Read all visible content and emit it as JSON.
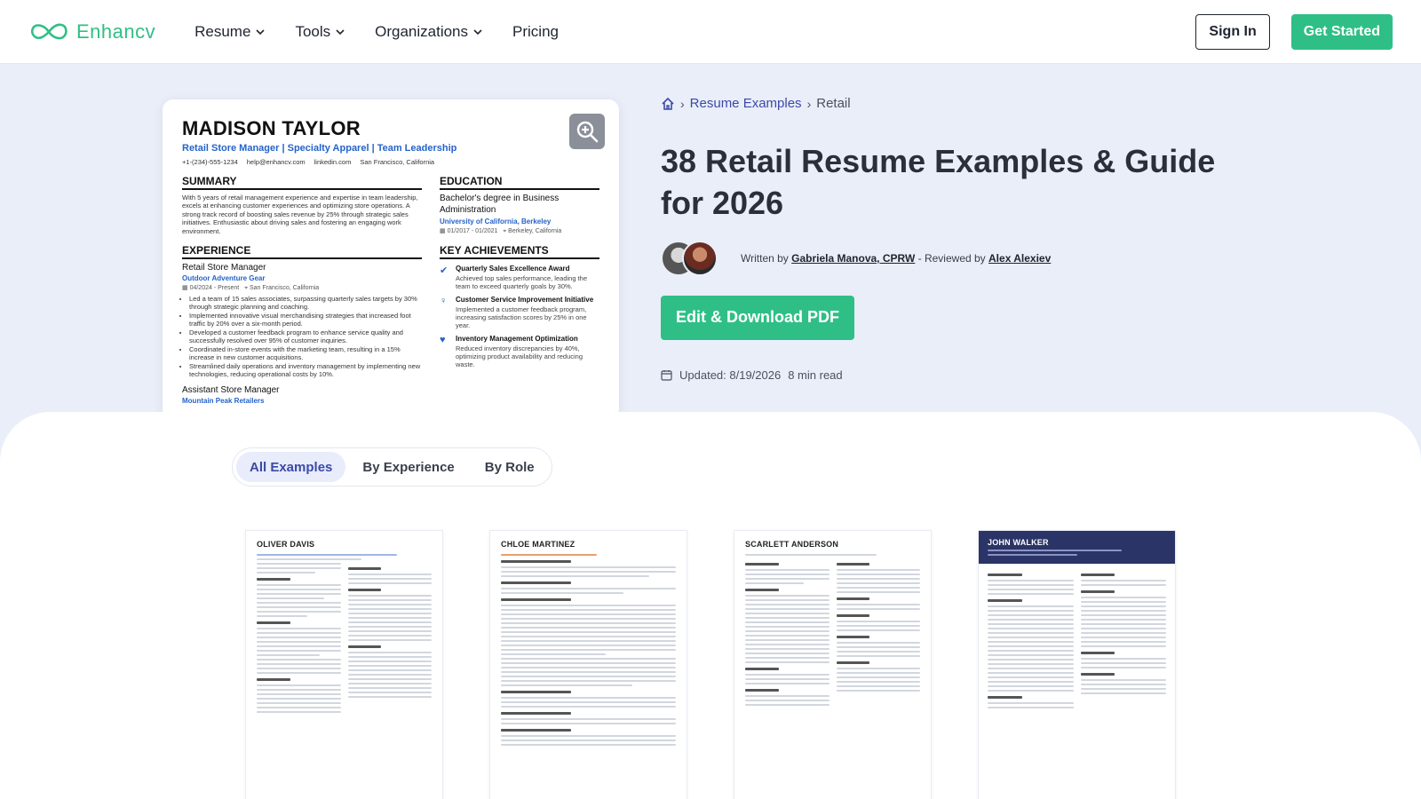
{
  "brand": {
    "name": "Enhancv",
    "color": "#2fbf86"
  },
  "nav": {
    "items": [
      {
        "label": "Resume",
        "has_dropdown": true
      },
      {
        "label": "Tools",
        "has_dropdown": true
      },
      {
        "label": "Organizations",
        "has_dropdown": true
      },
      {
        "label": "Pricing",
        "has_dropdown": false
      }
    ],
    "sign_in": "Sign In",
    "get_started": "Get Started"
  },
  "resume": {
    "name": "MADISON TAYLOR",
    "role": "Retail Store Manager | Specialty Apparel | Team Leadership",
    "contact": [
      "+1-(234)-555-1234",
      "help@enhancv.com",
      "linkedin.com",
      "San Francisco, California"
    ],
    "summary_h": "SUMMARY",
    "summary": "With 5 years of retail management experience and expertise in team leadership, excels at enhancing customer experiences and optimizing store operations. A strong track record of boosting sales revenue by 25% through strategic sales initiatives. Enthusiastic about driving sales and fostering an engaging work environment.",
    "experience_h": "EXPERIENCE",
    "job1": {
      "title": "Retail Store Manager",
      "company": "Outdoor Adventure Gear",
      "dates": "04/2024 - Present",
      "location": "San Francisco, California",
      "bullets": [
        "Led a team of 15 sales associates, surpassing quarterly sales targets by 30% through strategic planning and coaching.",
        "Implemented innovative visual merchandising strategies that increased foot traffic by 20% over a six-month period.",
        "Developed a customer feedback program to enhance service quality and successfully resolved over 95% of customer inquiries.",
        "Coordinated in-store events with the marketing team, resulting in a 15% increase in new customer acquisitions.",
        "Streamlined daily operations and inventory management by implementing new technologies, reducing operational costs by 10%."
      ]
    },
    "job2": {
      "title": "Assistant Store Manager",
      "company": "Mountain Peak Retailers"
    },
    "education_h": "EDUCATION",
    "edu": {
      "degree": "Bachelor's degree in Business Administration",
      "school": "University of California, Berkeley",
      "dates": "01/2017 - 01/2021",
      "location": "Berkeley, California"
    },
    "achievements_h": "KEY ACHIEVEMENTS",
    "achievements": [
      {
        "icon": "check-icon",
        "title": "Quarterly Sales Excellence Award",
        "desc": "Achieved top sales performance, leading the team to exceed quarterly goals by 30%."
      },
      {
        "icon": "lightbulb-icon",
        "title": "Customer Service Improvement Initiative",
        "desc": "Implemented a customer feedback program, increasing satisfaction scores by 25% in one year."
      },
      {
        "icon": "heart-icon",
        "title": "Inventory Management Optimization",
        "desc": "Reduced inventory discrepancies by 40%, optimizing product availability and reducing waste."
      }
    ]
  },
  "breadcrumb": {
    "home_icon": "home-icon",
    "section": "Resume Examples",
    "current": "Retail"
  },
  "page": {
    "title": "38 Retail Resume Examples & Guide for 2026",
    "written_by_label": "Written by",
    "author": "Gabriela Manova, CPRW",
    "reviewed_by_label": "- Reviewed by",
    "reviewer": "Alex Alexiev",
    "cta": "Edit & Download PDF",
    "updated": "Updated: 8/19/2026",
    "read_time": "8 min read"
  },
  "tabs": [
    {
      "label": "All Examples",
      "active": true
    },
    {
      "label": "By Experience",
      "active": false
    },
    {
      "label": "By Role",
      "active": false
    }
  ],
  "thumbnails": [
    {
      "name": "OLIVER DAVIS",
      "style": "light"
    },
    {
      "name": "CHLOE MARTINEZ",
      "style": "light"
    },
    {
      "name": "SCARLETT ANDERSON",
      "style": "light"
    },
    {
      "name": "JOHN WALKER",
      "style": "dark"
    }
  ]
}
